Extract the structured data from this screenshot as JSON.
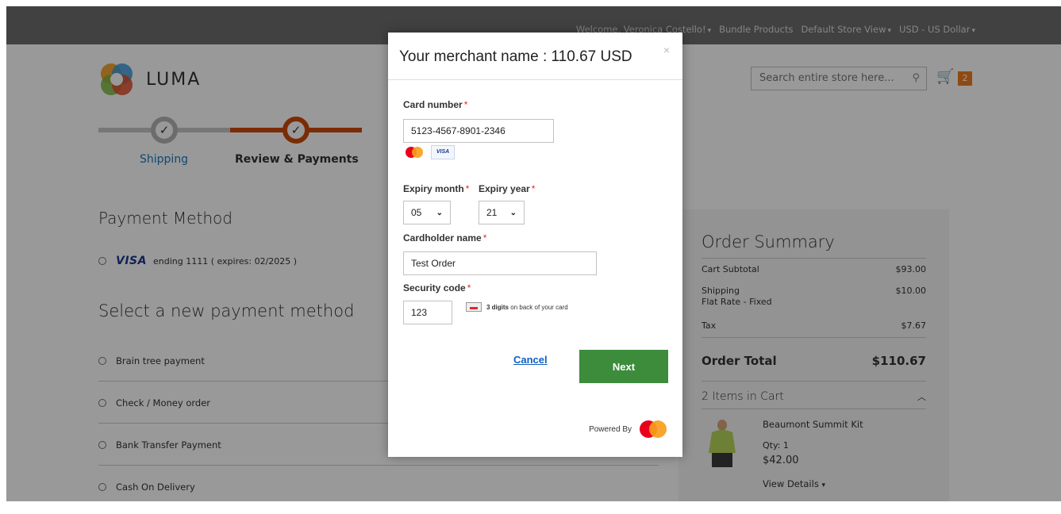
{
  "topbar": {
    "welcome": "Welcome, Veronica Costello!",
    "links": [
      "Bundle Products",
      "Default Store View",
      "USD - US Dollar"
    ]
  },
  "header": {
    "logo_text": "LUMA",
    "search_placeholder": "Search entire store here...",
    "cart_count": "2"
  },
  "progress": {
    "steps": [
      "Shipping",
      "Review & Payments"
    ],
    "completed": [
      true,
      true
    ]
  },
  "payment": {
    "title": "Payment Method",
    "saved_card_brand": "VISA",
    "saved_card_text": "ending 1111 ( expires: 02/2025 )",
    "new_title": "Select a new payment method",
    "methods": [
      "Brain tree payment",
      "Check / Money order",
      "Bank Transfer Payment",
      "Cash On Delivery"
    ]
  },
  "summary": {
    "title": "Order Summary",
    "rows": [
      {
        "label": "Cart Subtotal",
        "value": "$93.00"
      },
      {
        "label": "Shipping",
        "sub": "Flat Rate - Fixed",
        "value": "$10.00"
      },
      {
        "label": "Tax",
        "value": "$7.67"
      }
    ],
    "total_label": "Order Total",
    "total_value": "$110.67",
    "items_label": "2 Items in Cart",
    "product": {
      "name": "Beaumont Summit Kit",
      "qty": "Qty: 1",
      "price": "$42.00",
      "details": "View Details"
    }
  },
  "modal": {
    "title": "Your merchant name : 110.67 USD",
    "close": "×",
    "card_number_label": "Card number",
    "card_number_value": "5123-4567-8901-2346",
    "visa_mini": "VISA",
    "expiry_month_label": "Expiry month",
    "expiry_month_value": "05",
    "expiry_year_label": "Expiry year",
    "expiry_year_value": "21",
    "cardholder_label": "Cardholder name",
    "cardholder_value": "Test Order",
    "security_label": "Security code",
    "security_value": "123",
    "cvv_hint_bold": "3 digits",
    "cvv_hint_rest": "on back of your card",
    "cancel": "Cancel",
    "next": "Next",
    "powered_by": "Powered By",
    "required_mark": "*"
  },
  "colors": {
    "accent_orange": "#cc4a0b",
    "next_green": "#3c8c3c",
    "link_blue": "#1060c0",
    "cart_badge": "#f17b1b"
  }
}
